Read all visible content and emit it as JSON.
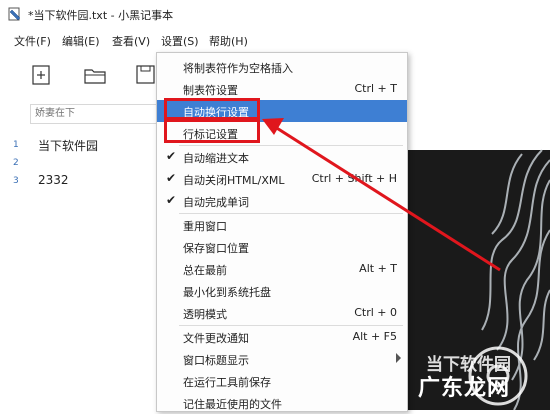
{
  "window": {
    "title": "*当下软件园.txt - 小黑记事本"
  },
  "menubar": [
    "文件(F)",
    "编辑(E)",
    "查看(V)",
    "设置(S)",
    "帮助(H)"
  ],
  "search": {
    "placeholder": "娇妻在下"
  },
  "editor": {
    "line_numbers": [
      "1",
      "2",
      "3"
    ],
    "lines": [
      "当下软件园",
      "",
      "2332"
    ]
  },
  "settings_menu": {
    "items": [
      {
        "label": "将制表符作为空格插入",
        "shortcut": "",
        "checked": false
      },
      {
        "label": "制表符设置",
        "shortcut": "Ctrl + T",
        "checked": false
      },
      {
        "label": "自动换行设置",
        "shortcut": "",
        "checked": false,
        "highlighted": true
      },
      {
        "label": "行标记设置",
        "shortcut": "",
        "checked": false
      },
      {
        "label": "自动缩进文本",
        "shortcut": "",
        "checked": true
      },
      {
        "label": "自动关闭HTML/XML",
        "shortcut": "Ctrl + Shift + H",
        "checked": true
      },
      {
        "label": "自动完成单词",
        "shortcut": "",
        "checked": true
      },
      {
        "label": "重用窗口",
        "shortcut": "",
        "checked": false
      },
      {
        "label": "保存窗口位置",
        "shortcut": "",
        "checked": false
      },
      {
        "label": "总在最前",
        "shortcut": "Alt + T",
        "checked": false
      },
      {
        "label": "最小化到系统托盘",
        "shortcut": "",
        "checked": false
      },
      {
        "label": "透明模式",
        "shortcut": "Ctrl + 0",
        "checked": false
      },
      {
        "label": "文件更改通知",
        "shortcut": "Alt + F5",
        "checked": false
      },
      {
        "label": "窗口标题显示",
        "shortcut": "",
        "checked": false,
        "submenu": true
      },
      {
        "label": "在运行工具前保存",
        "shortcut": "",
        "checked": false
      },
      {
        "label": "记住最近使用的文件",
        "shortcut": "",
        "checked": false
      }
    ]
  },
  "watermark": {
    "line1": "当下软件园",
    "line2": "广东龙网"
  },
  "colors": {
    "highlight": "#3e7fd3",
    "annotation": "#e0161d"
  }
}
